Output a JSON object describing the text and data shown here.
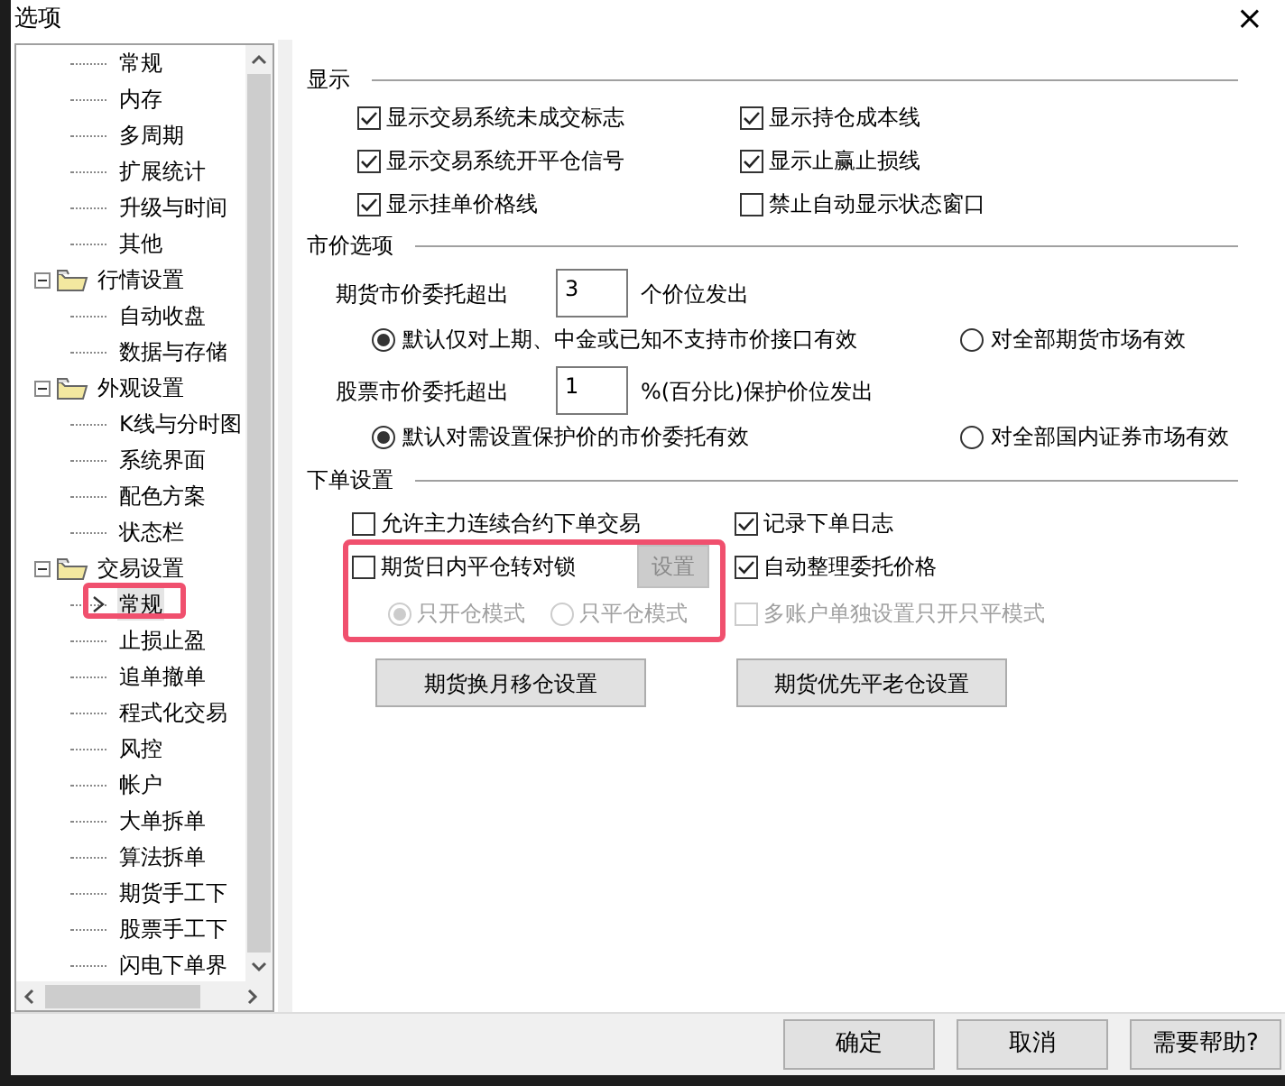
{
  "window": {
    "title": "选项",
    "close": "×"
  },
  "tree": {
    "items": [
      {
        "kind": "leaf",
        "label": "常规",
        "selected": false,
        "annotated": false
      },
      {
        "kind": "leaf",
        "label": "内存",
        "selected": false,
        "annotated": false
      },
      {
        "kind": "leaf",
        "label": "多周期",
        "selected": false,
        "annotated": false
      },
      {
        "kind": "leaf",
        "label": "扩展统计",
        "selected": false,
        "annotated": false
      },
      {
        "kind": "leaf",
        "label": "升级与时间",
        "selected": false,
        "annotated": false
      },
      {
        "kind": "leaf",
        "label": "其他",
        "selected": false,
        "annotated": false
      },
      {
        "kind": "group",
        "label": "行情设置",
        "expanded": true,
        "children": [
          {
            "label": "自动收盘",
            "selected": false,
            "annotated": false
          },
          {
            "label": "数据与存储",
            "selected": false,
            "annotated": false
          }
        ]
      },
      {
        "kind": "group",
        "label": "外观设置",
        "expanded": true,
        "children": [
          {
            "label": "K线与分时图",
            "selected": false,
            "annotated": false
          },
          {
            "label": "系统界面",
            "selected": false,
            "annotated": false
          },
          {
            "label": "配色方案",
            "selected": false,
            "annotated": false
          },
          {
            "label": "状态栏",
            "selected": false,
            "annotated": false
          }
        ]
      },
      {
        "kind": "group",
        "label": "交易设置",
        "expanded": true,
        "children": [
          {
            "label": "常规",
            "selected": true,
            "annotated": true
          },
          {
            "label": "止损止盈",
            "selected": false,
            "annotated": false
          },
          {
            "label": "追单撤单",
            "selected": false,
            "annotated": false
          },
          {
            "label": "程式化交易",
            "selected": false,
            "annotated": false
          },
          {
            "label": "风控",
            "selected": false,
            "annotated": false
          },
          {
            "label": "帐户",
            "selected": false,
            "annotated": false
          },
          {
            "label": "大单拆单",
            "selected": false,
            "annotated": false
          },
          {
            "label": "算法拆单",
            "selected": false,
            "annotated": false
          },
          {
            "label": "期货手工下",
            "selected": false,
            "annotated": false
          },
          {
            "label": "股票手工下",
            "selected": false,
            "annotated": false
          },
          {
            "label": "闪电下单界",
            "selected": false,
            "annotated": false
          }
        ]
      }
    ]
  },
  "display": {
    "title": "显示",
    "items": [
      {
        "label": "显示交易系统未成交标志",
        "checked": true
      },
      {
        "label": "显示持仓成本线",
        "checked": true
      },
      {
        "label": "显示交易系统开平仓信号",
        "checked": true
      },
      {
        "label": "显示止赢止损线",
        "checked": true
      },
      {
        "label": "显示挂单价格线",
        "checked": true
      },
      {
        "label": "禁止自动显示状态窗口",
        "checked": false
      }
    ]
  },
  "market": {
    "title": "市价选项",
    "rows": [
      {
        "label": "期货市价委托超出",
        "value": "3",
        "suffix": "个价位发出",
        "options": [
          {
            "label": "默认仅对上期、中金或已知不支持市价接口有效",
            "selected": true
          },
          {
            "label": "对全部期货市场有效",
            "selected": false
          }
        ]
      },
      {
        "label": "股票市价委托超出",
        "value": "1",
        "suffix": "%(百分比)保护价位发出",
        "options": [
          {
            "label": "默认对需设置保护价的市价委托有效",
            "selected": true
          },
          {
            "label": "对全部国内证券市场有效",
            "selected": false
          }
        ]
      }
    ]
  },
  "order": {
    "title": "下单设置",
    "main_contract": {
      "label": "允许主力连续合约下单交易",
      "checked": false,
      "disabled": false
    },
    "log": {
      "label": "记录下单日志",
      "checked": true,
      "disabled": false
    },
    "lock": {
      "annotated": true,
      "checkbox": {
        "label": "期货日内平仓转对锁",
        "checked": false,
        "disabled": false
      },
      "button": {
        "label": "设置",
        "disabled": true
      },
      "modes": [
        {
          "label": "只开仓模式",
          "selected": true,
          "disabled": true
        },
        {
          "label": "只平仓模式",
          "selected": false,
          "disabled": true
        }
      ]
    },
    "auto_price": {
      "label": "自动整理委托价格",
      "checked": true,
      "disabled": false
    },
    "multi_account": {
      "label": "多账户单独设置只开只平模式",
      "checked": false,
      "disabled": true
    },
    "buttons": [
      "期货换月移仓设置",
      "期货优先平老仓设置"
    ]
  },
  "footer": {
    "buttons": [
      "确定",
      "取消",
      "需要帮助?"
    ]
  }
}
